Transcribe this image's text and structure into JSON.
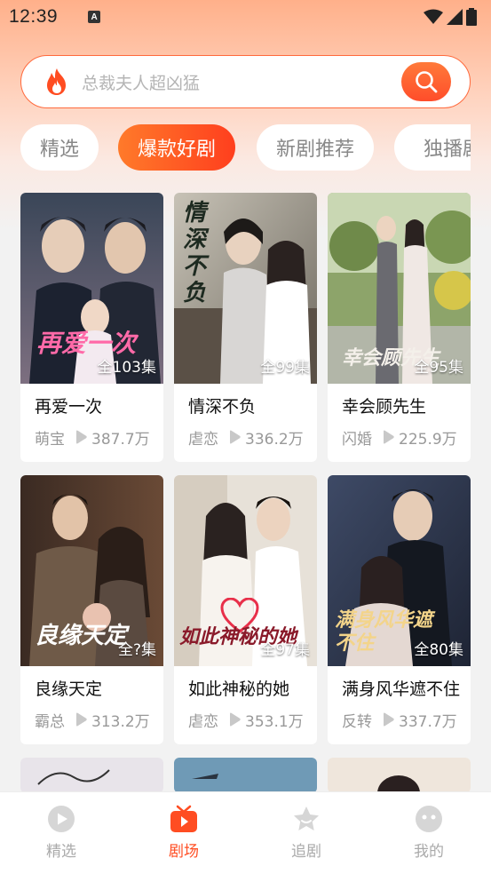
{
  "status_bar": {
    "time": "12:39",
    "notification_badge": "A"
  },
  "search": {
    "placeholder": "总裁夫人超凶猛"
  },
  "tabs": [
    {
      "label": "精选",
      "active": false
    },
    {
      "label": "爆款好剧",
      "active": true
    },
    {
      "label": "新剧推荐",
      "active": false
    },
    {
      "label": "独播剧",
      "active": false
    }
  ],
  "dramas": [
    {
      "title": "再爱一次",
      "genre": "萌宝",
      "views": "387.7万",
      "episodes": "全103集",
      "poster_text": "再爱一次"
    },
    {
      "title": "情深不负",
      "genre": "虐恋",
      "views": "336.2万",
      "episodes": "全99集",
      "poster_text": "情深不负"
    },
    {
      "title": "幸会顾先生",
      "genre": "闪婚",
      "views": "225.9万",
      "episodes": "全95集",
      "poster_text": "幸会顾先生"
    },
    {
      "title": "良缘天定",
      "genre": "霸总",
      "views": "313.2万",
      "episodes": "全?集",
      "poster_text": "良缘天定"
    },
    {
      "title": "如此神秘的她",
      "genre": "虐恋",
      "views": "353.1万",
      "episodes": "全97集",
      "poster_text": "如此神秘的她"
    },
    {
      "title": "满身风华遮不住",
      "genre": "反转",
      "views": "337.7万",
      "episodes": "全80集",
      "poster_text": "满身风华遮不住"
    }
  ],
  "bottom_nav": [
    {
      "label": "精选",
      "icon": "play-circle-icon",
      "active": false
    },
    {
      "label": "剧场",
      "icon": "tv-icon",
      "active": true
    },
    {
      "label": "追剧",
      "icon": "star-icon",
      "active": false
    },
    {
      "label": "我的",
      "icon": "face-icon",
      "active": false
    }
  ],
  "colors": {
    "accent": "#ff4d22",
    "accent_light": "#ff7a2a",
    "inactive": "#aaaaaa"
  }
}
